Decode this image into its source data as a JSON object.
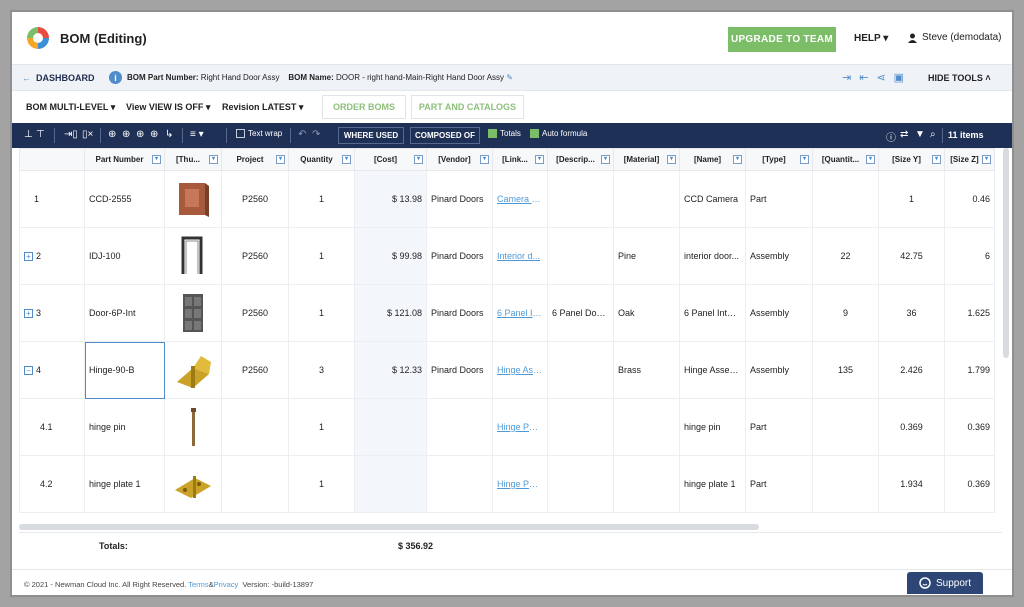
{
  "app": {
    "title": "BOM (Editing)"
  },
  "topbar": {
    "upgrade_label": "UPGRADE TO TEAM",
    "help_label": "HELP",
    "user_label": "Steve (demodata)"
  },
  "subbar": {
    "dashboard_label": "DASHBOARD",
    "part_number_key": "BOM Part Number:",
    "part_number_value": "Right Hand Door Assy",
    "bom_name_key": "BOM Name:",
    "bom_name_value": "DOOR - right hand-Main-Right Hand Door Assy",
    "hide_tools_label": "HIDE TOOLS"
  },
  "menu": {
    "bom_key": "BOM",
    "bom_value": "MULTI-LEVEL",
    "view_key": "View",
    "view_value": "VIEW IS OFF",
    "revision_key": "Revision",
    "revision_value": "LATEST",
    "order_boms": "ORDER BOMS",
    "part_catalogs": "PART AND CATALOGS"
  },
  "toolbar": {
    "text_wrap": "Text wrap",
    "where_used": "WHERE USED",
    "composed_of": "COMPOSED OF",
    "totals": "Totals",
    "auto_formula": "Auto formula",
    "items_count": "11 items"
  },
  "table": {
    "headers": [
      "",
      "Part Number",
      "[Thu...",
      "Project",
      "Quantity",
      "[Cost]",
      "[Vendor]",
      "[Link...",
      "[Descrip...",
      "[Material]",
      "[Name]",
      "[Type]",
      "[Quantit...",
      "[Size Y]",
      "[Size Z]"
    ],
    "rows": [
      {
        "idx": "1",
        "part": "CCD-2555",
        "thumb": "block",
        "project": "P2560",
        "qty": "1",
        "cost": "$ 13.98",
        "vendor": "Pinard Doors",
        "link": "Camera P...",
        "desc": "",
        "material": "",
        "name": "CCD Camera",
        "type": "Part",
        "qty2": "",
        "sizey": "1",
        "sizez": "0.46"
      },
      {
        "idx": "2",
        "part": "IDJ-100",
        "thumb": "frame",
        "project": "P2560",
        "qty": "1",
        "cost": "$ 99.98",
        "vendor": "Pinard Doors",
        "link": "Interior d...",
        "desc": "",
        "material": "Pine",
        "name": "interior door...",
        "type": "Assembly",
        "qty2": "22",
        "sizey": "42.75",
        "sizez": "6"
      },
      {
        "idx": "3",
        "part": "Door-6P-Int",
        "thumb": "panel",
        "project": "P2560",
        "qty": "1",
        "cost": "$ 121.08",
        "vendor": "Pinard Doors",
        "link": "6 Panel In...",
        "desc": "6 Panel Door...",
        "material": "Oak",
        "name": "6 Panel Inter...",
        "type": "Assembly",
        "qty2": "9",
        "sizey": "36",
        "sizez": "1.625"
      },
      {
        "idx": "4",
        "part": "Hinge-90-B",
        "thumb": "hinge",
        "project": "P2560",
        "qty": "3",
        "cost": "$ 12.33",
        "vendor": "Pinard Doors",
        "link": "Hinge Ass...",
        "desc": "",
        "material": "Brass",
        "name": "Hinge Assem...",
        "type": "Assembly",
        "qty2": "135",
        "sizey": "2.426",
        "sizez": "1.799"
      },
      {
        "idx": "4.1",
        "part": "hinge pin",
        "thumb": "pin",
        "project": "",
        "qty": "1",
        "cost": "",
        "vendor": "",
        "link": "Hinge Par...",
        "desc": "",
        "material": "",
        "name": "hinge pin",
        "type": "Part",
        "qty2": "",
        "sizey": "0.369",
        "sizez": "0.369"
      },
      {
        "idx": "4.2",
        "part": "hinge plate 1",
        "thumb": "plate",
        "project": "",
        "qty": "1",
        "cost": "",
        "vendor": "",
        "link": "Hinge Par...",
        "desc": "",
        "material": "",
        "name": "hinge plate 1",
        "type": "Part",
        "qty2": "",
        "sizey": "1.934",
        "sizez": "0.369"
      }
    ]
  },
  "totals": {
    "label": "Totals:",
    "cost": "$ 356.92"
  },
  "footer": {
    "copyright": "© 2021 - Newman Cloud Inc. All Right Reserved.",
    "terms": "Terms",
    "amp": "&",
    "privacy": "Privacy",
    "version": "Version: -build-13897",
    "support": "Support"
  },
  "colors": {
    "accent_green": "#7cbd68",
    "navy": "#1f3056",
    "link_blue": "#4f9ad6"
  }
}
